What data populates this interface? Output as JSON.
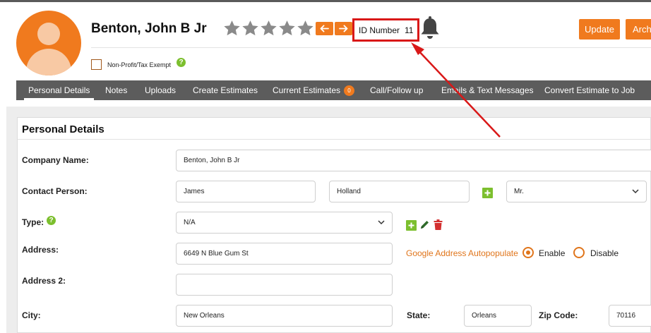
{
  "customer": {
    "name": "Benton, John B Jr",
    "rating": {
      "value": 0,
      "max": 5
    },
    "id_label": "ID Number",
    "id_value": "11"
  },
  "header": {
    "update_label": "Update",
    "archive_label": "Archi",
    "nonprofit_label": "Non-Profit/Tax Exempt",
    "nonprofit_checked": false,
    "help_glyph": "?"
  },
  "tabs": [
    {
      "label": "Personal Details",
      "active": true
    },
    {
      "label": "Notes"
    },
    {
      "label": "Uploads"
    },
    {
      "label": "Create Estimates"
    },
    {
      "label": "Current Estimates",
      "badge": "0"
    },
    {
      "label": "Call/Follow up"
    },
    {
      "label": "Emails & Text Messages"
    },
    {
      "label": "Convert Estimate to Job"
    }
  ],
  "form": {
    "section_title": "Personal Details",
    "company_label": "Company Name:",
    "company_value": "Benton, John B Jr",
    "contact_label": "Contact Person:",
    "first_name": "James",
    "last_name": "Holland",
    "salutation": "Mr.",
    "type_label": "Type:",
    "type_value": "N/A",
    "address_label": "Address:",
    "address_value": "6649 N Blue Gum St",
    "address2_label": "Address 2:",
    "address2_value": "",
    "city_label": "City:",
    "city_value": "New Orleans",
    "state_label": "State:",
    "state_value": "Orleans",
    "zip_label": "Zip Code:",
    "zip_value": "70116",
    "autopopulate_label": "Google Address Autopopulate",
    "enable_label": "Enable",
    "disable_label": "Disable",
    "autopopulate_selected": "Enable"
  },
  "icons": [
    "user-avatar-icon",
    "star-icon",
    "arrow-left-icon",
    "arrow-right-icon",
    "bell-icon",
    "help-icon",
    "plus-icon",
    "pencil-icon",
    "trash-icon",
    "chevron-down-icon"
  ],
  "colors": {
    "accent": "#f07a1e",
    "tab_bar": "#5c5c5c",
    "highlight": "#d91818",
    "help_green": "#7cbf2e",
    "delete_red": "#d32f2f",
    "star_gray": "#8a8a8a"
  }
}
